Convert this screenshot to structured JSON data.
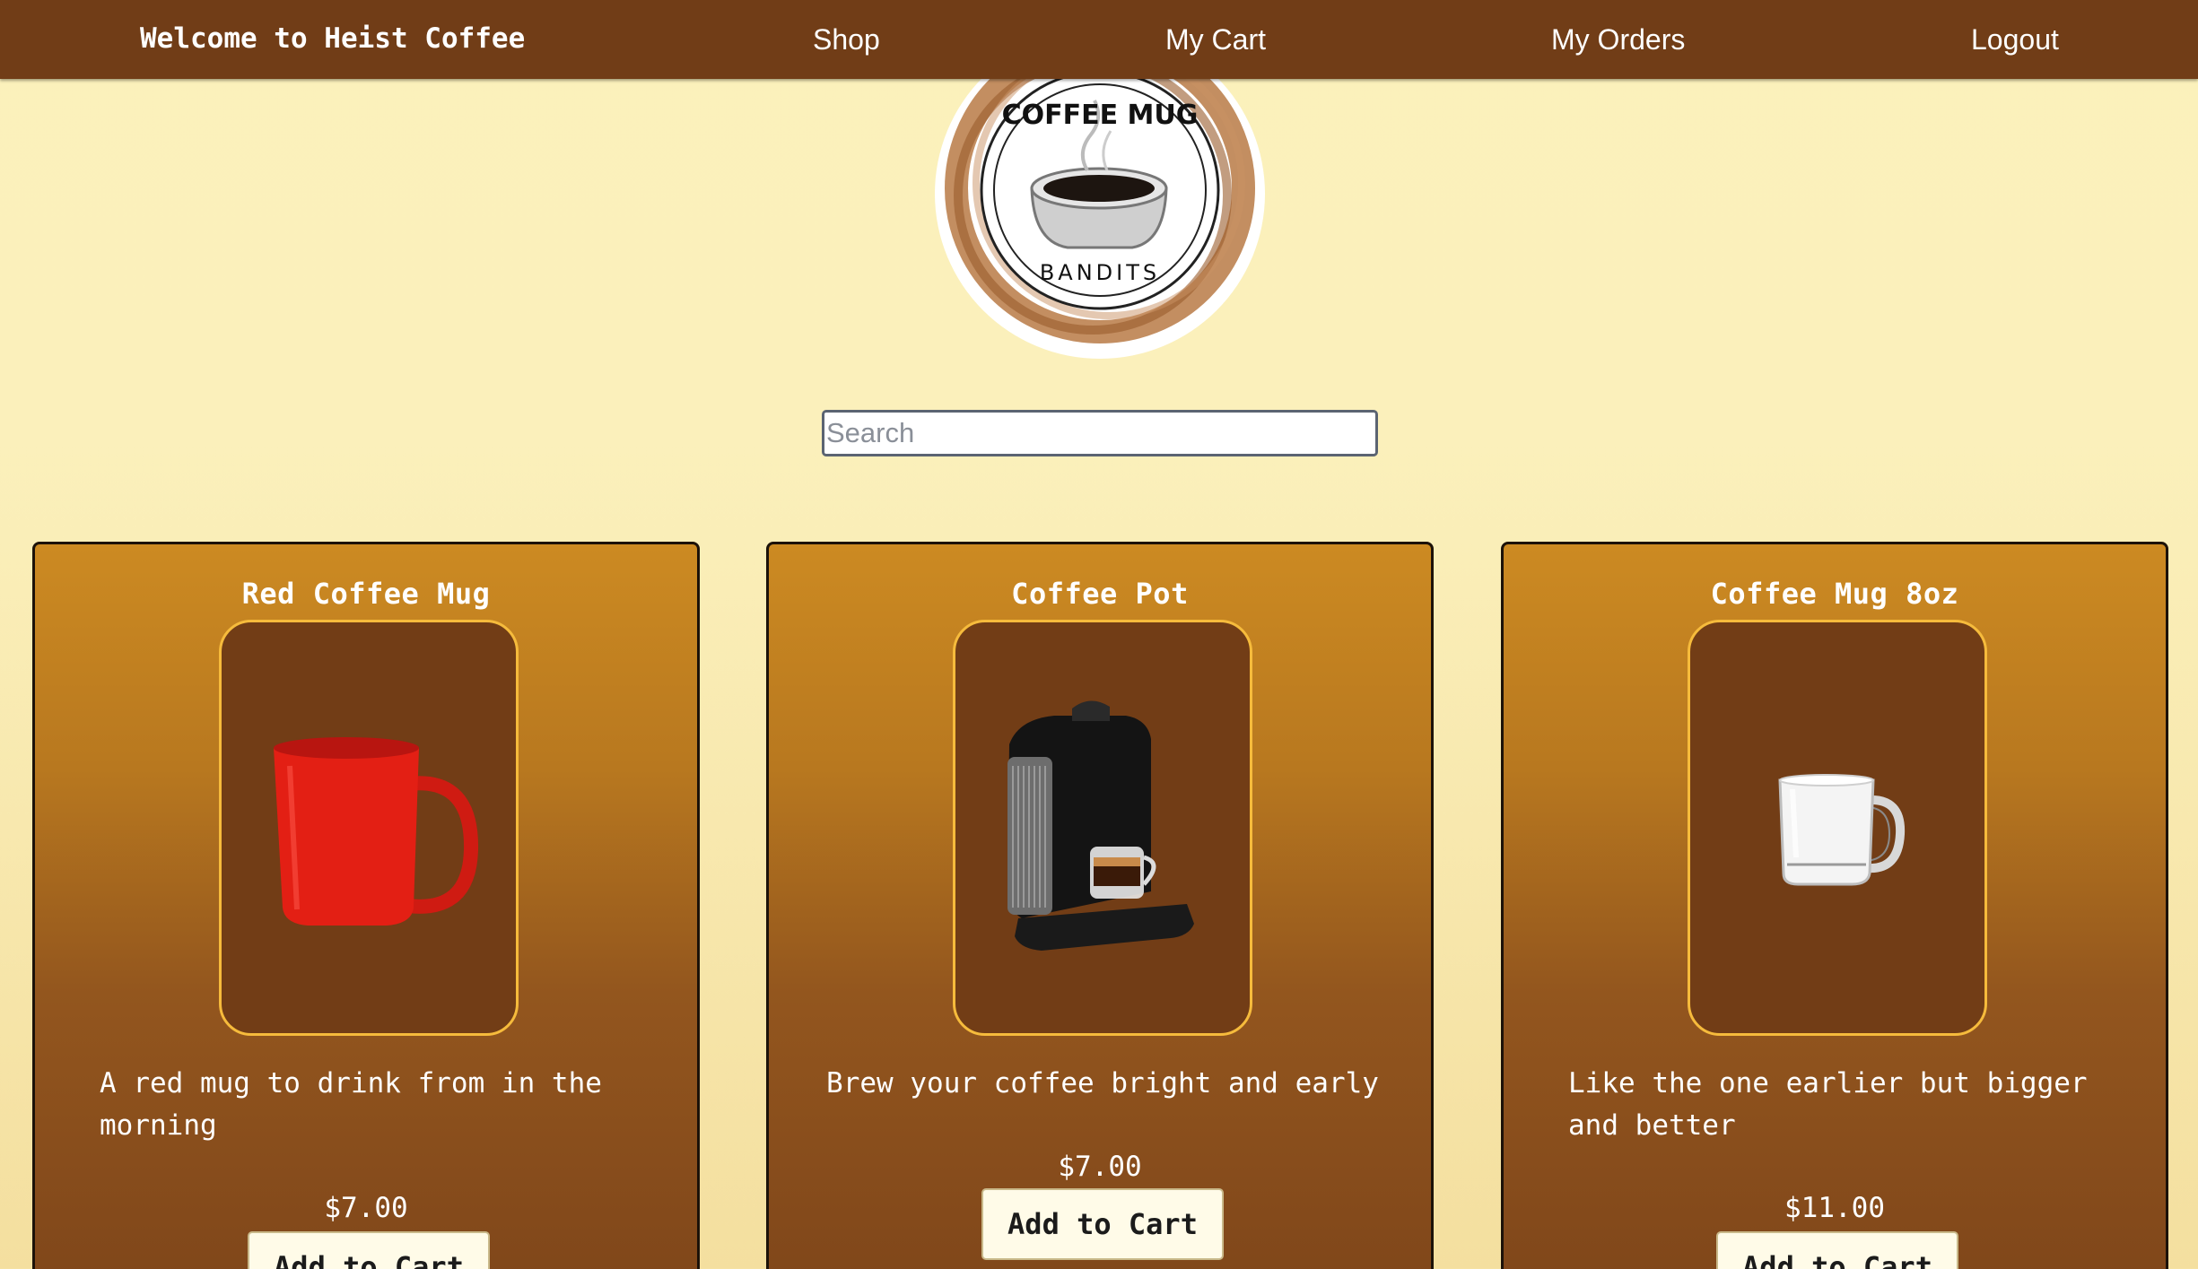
{
  "navbar": {
    "brand": "Welcome to Heist Coffee",
    "links": [
      "Shop",
      "My Cart",
      "My Orders",
      "Logout"
    ]
  },
  "logo": {
    "top_text": "COFFEE MUG",
    "bottom_text": "BANDITS"
  },
  "search": {
    "placeholder": "Search",
    "value": ""
  },
  "products": [
    {
      "title": "Red Coffee Mug",
      "description": "A red mug to drink from in the morning",
      "price": "$7.00",
      "button": "Add to Cart"
    },
    {
      "title": "Coffee Pot",
      "description": "Brew your coffee bright and early",
      "price": "$7.00",
      "button": "Add to Cart"
    },
    {
      "title": "Coffee Mug 8oz",
      "description": "Like the one earlier but bigger and better",
      "price": "$11.00",
      "button": "Add to Cart"
    }
  ],
  "colors": {
    "navbar": "#713d17",
    "card_top": "#cc8a22",
    "card_bottom": "#7f461a",
    "frame_border": "#f6bb3c",
    "frame_fill": "#723d16"
  }
}
